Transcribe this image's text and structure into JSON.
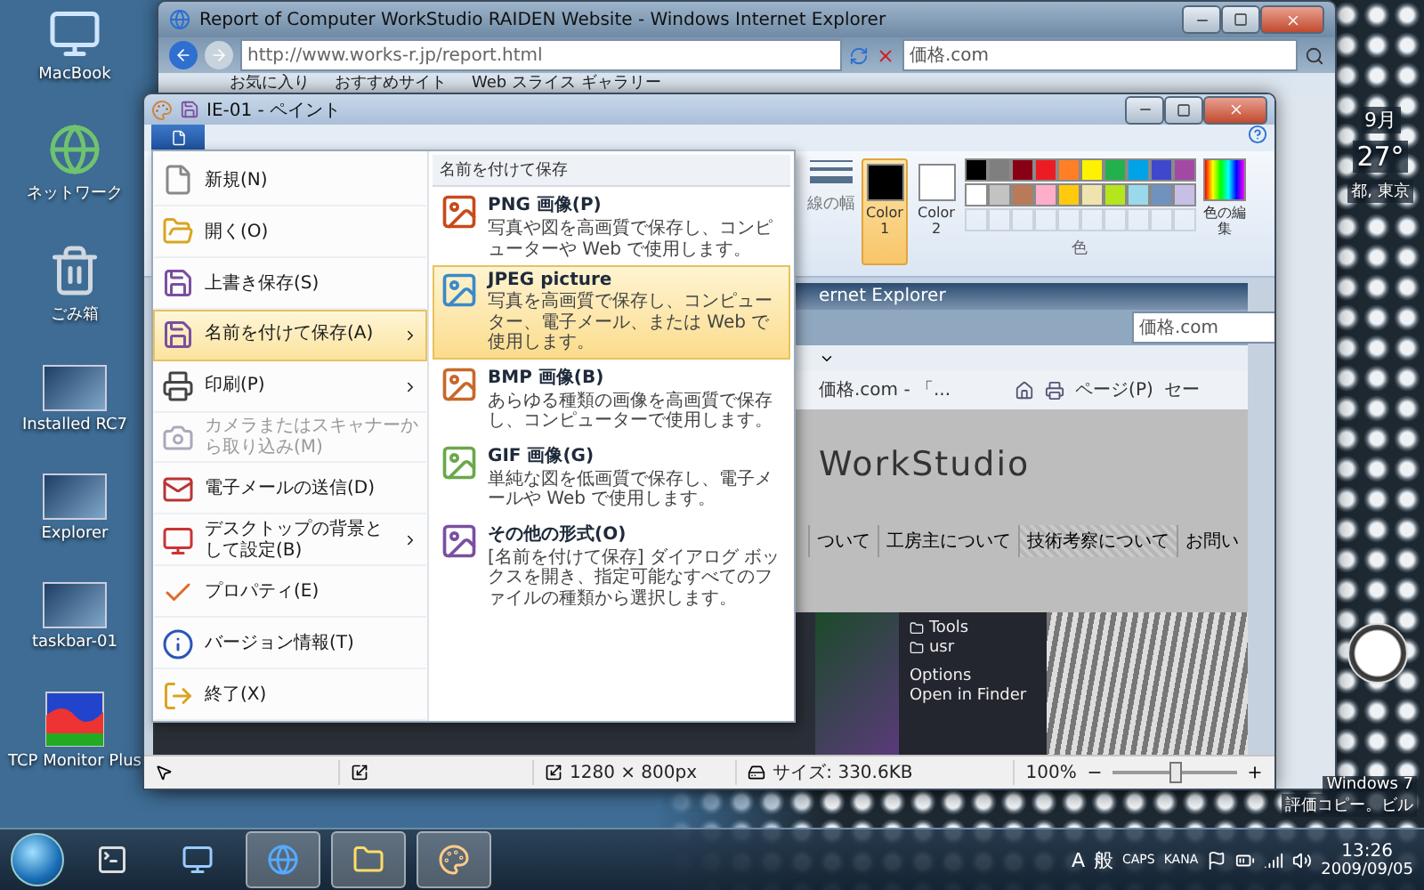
{
  "desktop_icons": [
    {
      "label": "MacBook"
    },
    {
      "label": "ネットワーク"
    },
    {
      "label": "ごみ箱"
    },
    {
      "label": "Installed RC7"
    },
    {
      "label": "Explorer"
    },
    {
      "label": "taskbar-01"
    },
    {
      "label": "TCP Monitor Plus"
    }
  ],
  "ie_window": {
    "title": "Report of Computer WorkStudio RAIDEN Website - Windows Internet Explorer",
    "address": "http://www.works-r.jp/report.html",
    "search": "価格.com",
    "favorites": [
      "お気に入り",
      "おすすめサイト",
      "Web スライス ギャラリー"
    ]
  },
  "paint_window": {
    "title": "IE-01 - ペイント",
    "ribbon": {
      "line_width": "線の幅",
      "colors": [
        {
          "label": "Color 1",
          "selected": true,
          "color": "#000000"
        },
        {
          "label": "Color 2",
          "selected": false,
          "color": "#ffffff"
        }
      ],
      "palette": [
        {
          "color": "#000000"
        },
        {
          "color": "#7f7f7f"
        },
        {
          "color": "#880015"
        },
        {
          "color": "#ed1c24"
        },
        {
          "color": "#ff7f27"
        },
        {
          "color": "#fff200"
        },
        {
          "color": "#22b14c"
        },
        {
          "color": "#00a2e8"
        },
        {
          "color": "#3f48cc"
        },
        {
          "color": "#a349a4"
        },
        {
          "color": "#ffffff"
        },
        {
          "color": "#c3c3c3"
        },
        {
          "color": "#b97a57"
        },
        {
          "color": "#ffaec9"
        },
        {
          "color": "#ffc90e"
        },
        {
          "color": "#efe4b0"
        },
        {
          "color": "#b5e61d"
        },
        {
          "color": "#99d9ea"
        },
        {
          "color": "#7092be"
        },
        {
          "color": "#c8bfe7"
        },
        {
          "empty": true
        },
        {
          "empty": true
        },
        {
          "empty": true
        },
        {
          "empty": true
        },
        {
          "empty": true
        },
        {
          "empty": true
        },
        {
          "empty": true
        },
        {
          "empty": true
        },
        {
          "empty": true
        },
        {
          "empty": true
        }
      ],
      "edit_colors": "色の編集",
      "group_label": "色"
    },
    "file_menu": [
      {
        "label": "新規(N)",
        "selected": false,
        "disabled": false,
        "submenu": false
      },
      {
        "label": "開く(O)",
        "selected": false,
        "disabled": false,
        "submenu": false
      },
      {
        "label": "上書き保存(S)",
        "selected": false,
        "disabled": false,
        "submenu": false
      },
      {
        "label": "名前を付けて保存(A)",
        "selected": true,
        "disabled": false,
        "submenu": true
      },
      {
        "label": "印刷(P)",
        "selected": false,
        "disabled": false,
        "submenu": true
      },
      {
        "label": "カメラまたはスキャナーから取り込み(M)",
        "selected": false,
        "disabled": true,
        "submenu": false
      },
      {
        "label": "電子メールの送信(D)",
        "selected": false,
        "disabled": false,
        "submenu": false
      },
      {
        "label": "デスクトップの背景として設定(B)",
        "selected": false,
        "disabled": false,
        "submenu": true
      },
      {
        "label": "プロパティ(E)",
        "selected": false,
        "disabled": false,
        "submenu": false
      },
      {
        "label": "バージョン情報(T)",
        "selected": false,
        "disabled": false,
        "submenu": false
      },
      {
        "label": "終了(X)",
        "selected": false,
        "disabled": false,
        "submenu": false
      }
    ],
    "save_as": {
      "heading": "名前を付けて保存",
      "items": [
        {
          "title": "PNG 画像(P)",
          "description": "写真や図を高画質で保存し、コンピューターや Web で使用します。",
          "selected": false
        },
        {
          "title": "JPEG picture",
          "description": "写真を高画質で保存し、コンピューター、電子メール、または Web で使用します。",
          "selected": true
        },
        {
          "title": "BMP 画像(B)",
          "description": "あらゆる種類の画像を高画質で保存し、コンピューターで使用します。",
          "selected": false
        },
        {
          "title": "GIF 画像(G)",
          "description": "単純な図を低画質で保存し、電子メールや Web で使用します。",
          "selected": false
        },
        {
          "title": "その他の形式(O)",
          "description": "[名前を付けて保存] ダイアログ ボックスを開き、指定可能なすべてのファイルの種類から選択します。",
          "selected": false
        }
      ]
    },
    "canvas_screenshot": {
      "title": "ernet Explorer",
      "search": "価格.com",
      "tab": "価格.com - 「...",
      "page_menu": "ページ(P)",
      "safety_menu": "セー",
      "logo": "WorkStudio",
      "nav": [
        {
          "label": "ついて",
          "selected": false
        },
        {
          "label": "工房主について",
          "selected": false
        },
        {
          "label": "技術考察について",
          "selected": true
        },
        {
          "label": "お問い",
          "selected": false
        }
      ],
      "folders": [
        "Tools",
        "usr"
      ],
      "menu_items": [
        "Options",
        "Open in Finder"
      ]
    },
    "status_bar": {
      "dimensions": "1280 × 800px",
      "size": "サイズ: 330.6KB",
      "zoom": "100%",
      "zoom_slider": {
        "level": 0.5
      }
    }
  },
  "gadgets": {
    "month": "9月",
    "temperature": "27°",
    "location": "都, 東京"
  },
  "os_notice": [
    "Windows 7",
    "評価コピー。ビル"
  ],
  "taskbar": {
    "tray": [
      "A",
      "般",
      "CAPS",
      "KANA"
    ],
    "time": "13:26",
    "date": "2009/09/05"
  }
}
